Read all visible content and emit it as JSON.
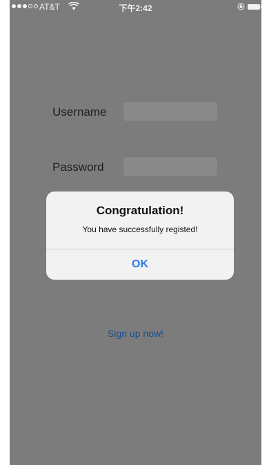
{
  "status_bar": {
    "carrier": "AT&T",
    "time": "下午2:42",
    "signal_bars_filled": 3,
    "signal_bars_total": 5,
    "icons": [
      "wifi-icon",
      "orientation-lock-icon",
      "battery-icon"
    ]
  },
  "form": {
    "username_label": "Username",
    "username_value": "",
    "password_label": "Password",
    "password_value": "",
    "signup_link": "Sign up now!"
  },
  "alert": {
    "title": "Congratulation!",
    "message": "You have successfully registed!",
    "button_label": "OK"
  },
  "colors": {
    "dimmed_background": "#7c7c7c",
    "alert_background": "#f2f2f2",
    "accent_blue": "#2a7be4",
    "link_blue": "#1a4f8f"
  }
}
